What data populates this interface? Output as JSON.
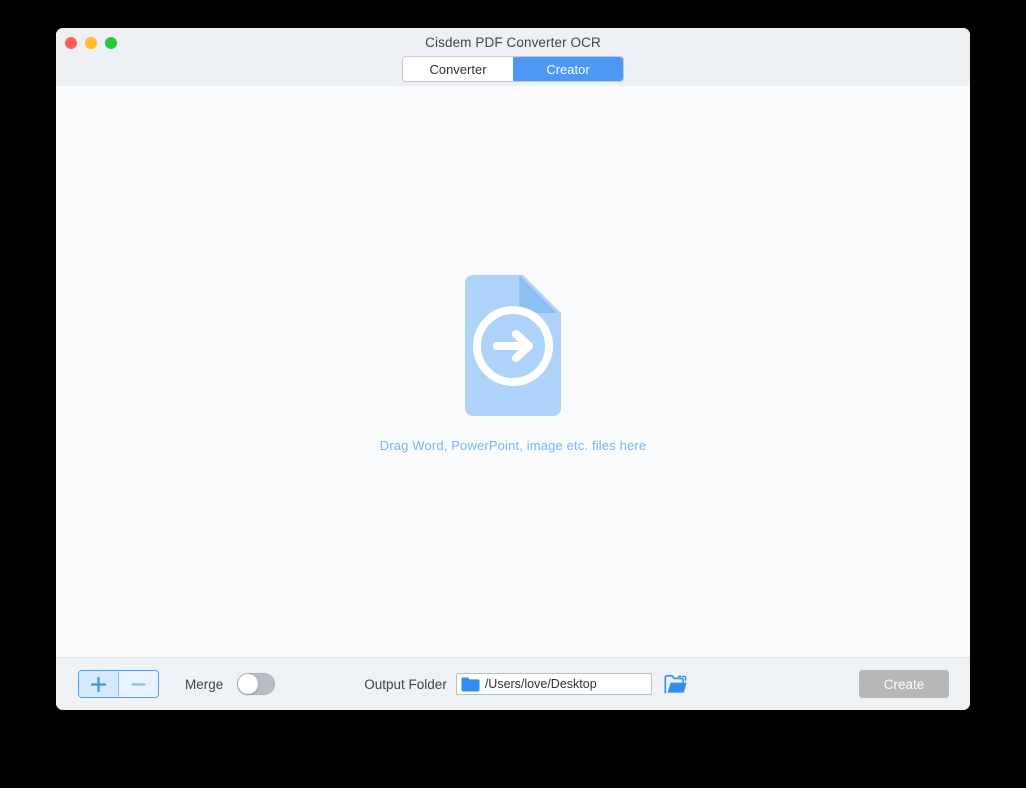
{
  "window": {
    "title": "Cisdem PDF Converter OCR",
    "traffic_lights": [
      {
        "name": "close",
        "color": "#ff5f57"
      },
      {
        "name": "minimize",
        "color": "#febc2e"
      },
      {
        "name": "zoom",
        "color": "#28c840"
      }
    ]
  },
  "mode_tabs": {
    "items": [
      {
        "label": "Converter",
        "active": false
      },
      {
        "label": "Creator",
        "active": true
      }
    ],
    "active_color": "#4d97f5"
  },
  "dropzone": {
    "icon": "document-import-arrow-icon",
    "icon_color": "#aed3f8",
    "icon_fold_color": "#8dc0f2",
    "hint": "Drag Word, PowerPoint, image etc. files here",
    "hint_color": "#7ab4f3"
  },
  "toolbar": {
    "add_label": "+",
    "add_icon": "plus-icon",
    "remove_label": "–",
    "remove_icon": "minus-icon",
    "merge_label": "Merge",
    "merge_enabled": false,
    "output_folder_label": "Output Folder",
    "output_folder_path": "/Users/love/Desktop",
    "output_folder_icon": "folder-icon",
    "browse_icon": "open-folder-icon",
    "create_label": "Create",
    "create_enabled": false,
    "create_disabled_color": "#b7b7b7"
  }
}
